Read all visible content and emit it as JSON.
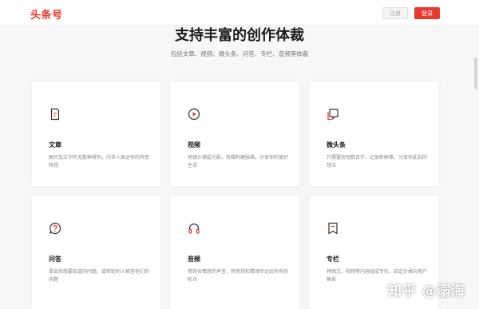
{
  "header": {
    "logo": "头条号",
    "register_label": "注册",
    "login_label": "登录"
  },
  "section": {
    "title": "支持丰富的创作体裁",
    "subtitle": "包括文章、视频、微头条、问答、专栏、音频等体裁"
  },
  "cards": [
    {
      "icon": "article-icon",
      "title": "文章",
      "desc": "图片加文字的无数种排列，向世人表达你的所思所想"
    },
    {
      "icon": "video-play-icon",
      "title": "视频",
      "desc": "用镜头捕捉光影，剪辑构建脉络，分享你的美好生活"
    },
    {
      "icon": "microheadline-icon",
      "title": "微头条",
      "desc": "只需要短短数百字，记录新鲜事，分享你此刻的想法"
    },
    {
      "icon": "question-icon",
      "title": "问答",
      "desc": "提出你想要知道的问题，或帮助别人解答他们的问题"
    },
    {
      "icon": "headphones-icon",
      "title": "音频",
      "desc": "用饱含情感的声音，将思想和情绪传达给所有的听众"
    },
    {
      "icon": "column-bookmark-icon",
      "title": "专栏",
      "desc": "将图文、视频等内容组成专栏，自定价格向用户售卖"
    }
  ],
  "watermark": "知乎 @溺海",
  "colors": {
    "accent": "#e8392e",
    "icon_dark": "#333333"
  }
}
